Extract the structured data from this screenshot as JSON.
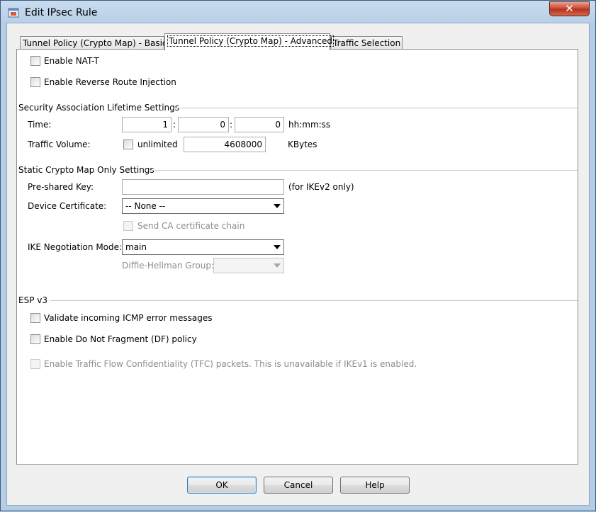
{
  "window": {
    "title": "Edit IPsec Rule",
    "close_glyph": "✕"
  },
  "tabs": [
    {
      "label": "Tunnel Policy (Crypto Map) - Basic",
      "active": false
    },
    {
      "label": "Tunnel Policy (Crypto Map) - Advanced",
      "active": true
    },
    {
      "label": "Traffic Selection",
      "active": false
    }
  ],
  "options": {
    "nat_t": "Enable NAT-T",
    "rri": "Enable Reverse Route Injection"
  },
  "sa_lifetime": {
    "heading": "Security Association Lifetime Settings",
    "time_label": "Time:",
    "hours": "1",
    "minutes": "0",
    "seconds": "0",
    "sep": ":",
    "time_unit": "hh:mm:ss",
    "volume_label": "Traffic Volume:",
    "unlimited_label": "unlimited",
    "volume_value": "4608000",
    "volume_unit": "KBytes"
  },
  "static_crypto": {
    "heading": "Static Crypto Map Only Settings",
    "psk_label": "Pre-shared Key:",
    "psk_value": "",
    "psk_note": "(for IKEv2 only)",
    "cert_label": "Device Certificate:",
    "cert_value": "-- None --",
    "ca_chain_label": "Send CA certificate chain",
    "ike_mode_label": "IKE Negotiation Mode:",
    "ike_mode_value": "main",
    "dh_label": "Diffie-Hellman Group:",
    "dh_value": ""
  },
  "esp_v3": {
    "heading": "ESP v3",
    "icmp_label": "Validate incoming ICMP error messages",
    "df_label": "Enable Do Not Fragment (DF)  policy",
    "tfc_label": "Enable Traffic Flow Confidentiality (TFC) packets. This is unavailable if IKEv1 is enabled."
  },
  "buttons": {
    "ok": "OK",
    "cancel": "Cancel",
    "help": "Help"
  },
  "icons": {
    "app": "app-window-icon",
    "dropdown": "chevron-down-icon"
  }
}
